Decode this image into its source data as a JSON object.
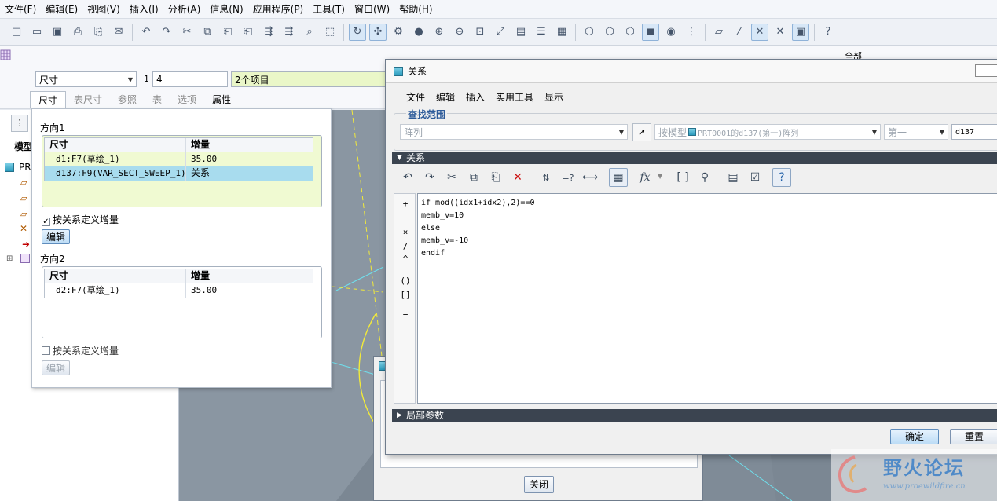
{
  "menu": [
    "文件(F)",
    "编辑(E)",
    "视图(V)",
    "插入(I)",
    "分析(A)",
    "信息(N)",
    "应用程序(P)",
    "工具(T)",
    "窗口(W)",
    "帮助(H)"
  ],
  "ribbon": {
    "dim_select": "尺寸",
    "count_label": "1",
    "count_value": "4",
    "items_value": "2个项目",
    "right_label": "全部"
  },
  "dim_tabs": [
    "尺寸",
    "表尺寸",
    "参照",
    "表",
    "选项",
    "属性"
  ],
  "tree": {
    "tab_label": "模型",
    "root_label": "PR"
  },
  "dim_panel": {
    "dir1_label": "方向1",
    "dir2_label": "方向2",
    "col_dim": "尺寸",
    "col_inc": "增量",
    "dir1_rows": [
      {
        "dim": "d1:F7(草绘_1)",
        "inc": "35.00"
      },
      {
        "dim": "d137:F9(VAR_SECT_SWEEP_1)",
        "inc": "关系"
      }
    ],
    "dir2_rows": [
      {
        "dim": "d2:F7(草绘_1)",
        "inc": "35.00"
      }
    ],
    "define_by_relation": "按关系定义增量",
    "edit_button": "编辑"
  },
  "relations_dialog": {
    "title": "关系",
    "menu": [
      "文件",
      "编辑",
      "插入",
      "实用工具",
      "显示"
    ],
    "scope_label": "查找范围",
    "scope_value": "阵列",
    "model_value": "按模型",
    "model_part": "PRT0001的d137(第一)阵列",
    "first_value": "第一",
    "dim_value": "d137",
    "relations_section": "关系",
    "local_params_section": "局部参数",
    "fx_label": "fx",
    "operators": [
      "+",
      "−",
      "×",
      "/",
      "^",
      "()",
      "[]",
      "="
    ],
    "code_lines": [
      "if mod((idx1+idx2),2)==0",
      "memb_v=10",
      "else",
      "memb_v=-10",
      "endif"
    ],
    "ok_button": "确定",
    "reset_button": "重置"
  },
  "back_dialog": {
    "close_button": "关闭"
  },
  "watermark": {
    "title": "野火论坛",
    "url": "www.proewildfire.cn"
  },
  "colors": {
    "section_bar": "#3b4450",
    "highlight_row": "#a8dcee",
    "group_bg": "#f0fad2",
    "graphics_bg": "#7b8793"
  }
}
